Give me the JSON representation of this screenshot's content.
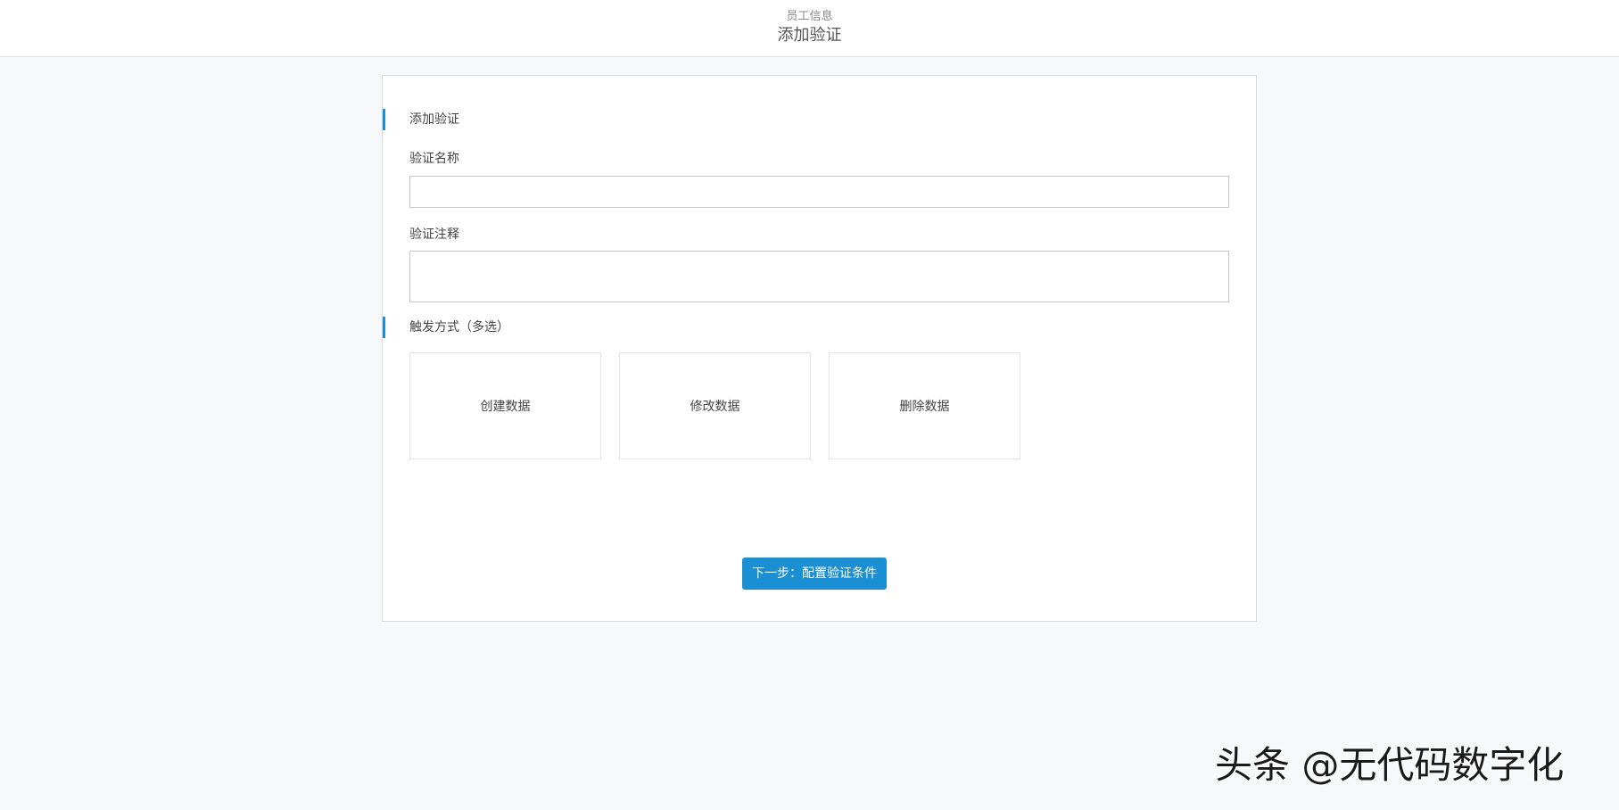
{
  "header": {
    "subtitle": "员工信息",
    "title": "添加验证"
  },
  "form": {
    "section_basic": "添加验证",
    "name_label": "验证名称",
    "name_value": "",
    "remark_label": "验证注释",
    "remark_value": "",
    "section_trigger": "触发方式（多选）",
    "trigger_options": [
      {
        "label": "创建数据"
      },
      {
        "label": "修改数据"
      },
      {
        "label": "删除数据"
      }
    ],
    "next_button": "下一步：配置验证条件"
  },
  "colors": {
    "accent": "#1a8fd4",
    "page_background": "#f7f8f9",
    "card_border": "#d7dade"
  },
  "watermark": "头条 @无代码数字化"
}
